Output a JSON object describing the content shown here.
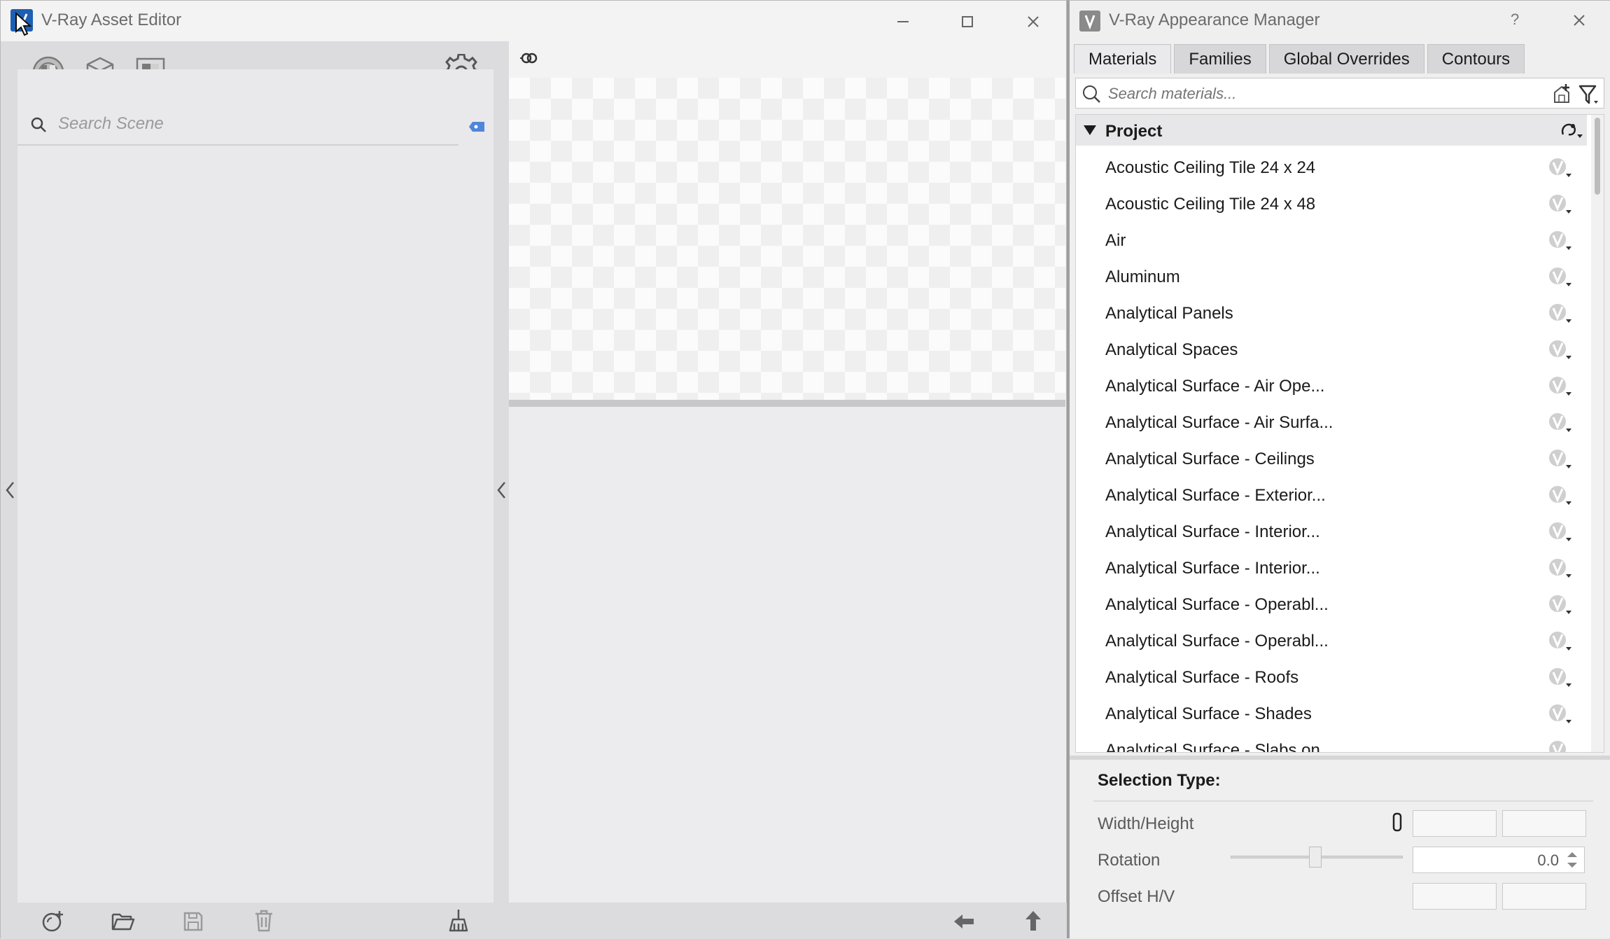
{
  "asset_editor": {
    "title": "V-Ray Asset Editor",
    "search_placeholder": "Search Scene"
  },
  "appearance_manager": {
    "title": "V-Ray Appearance Manager",
    "help": "?",
    "tabs": [
      "Materials",
      "Families",
      "Global Overrides",
      "Contours"
    ],
    "search_placeholder": "Search materials...",
    "group": "Project",
    "materials": [
      "Acoustic Ceiling Tile 24 x 24",
      "Acoustic Ceiling Tile 24 x 48",
      "Air",
      "Aluminum",
      "Analytical Panels",
      "Analytical Spaces",
      "Analytical Surface - Air Ope...",
      "Analytical Surface - Air Surfa...",
      "Analytical Surface - Ceilings",
      "Analytical Surface - Exterior...",
      "Analytical Surface - Interior...",
      "Analytical Surface - Interior...",
      "Analytical Surface - Operabl...",
      "Analytical Surface - Operabl...",
      "Analytical Surface - Roofs",
      "Analytical Surface - Shades",
      "Analytical Surface - Slabs on..."
    ],
    "selection_type_label": "Selection Type:",
    "props": {
      "width_height": "Width/Height",
      "rotation": "Rotation",
      "rotation_value": "0.0",
      "offset": "Offset H/V"
    }
  },
  "icons": {
    "app": "vray-logo-icon",
    "materials": "materials-sphere-icon",
    "geometry": "cube-icon",
    "textures": "texture-icon",
    "settings": "gear-icon"
  },
  "colors": {
    "accent_blue": "#1d5fb3",
    "tag_blue": "#4f86d9"
  }
}
